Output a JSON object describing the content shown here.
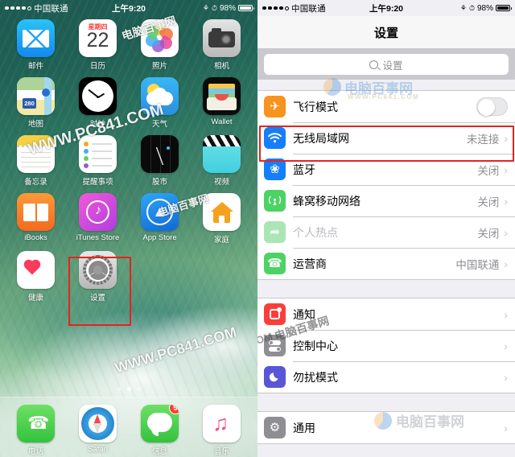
{
  "status_bar": {
    "carrier": "中国联通",
    "time": "上午9:20",
    "battery_percent": "98%",
    "signal_dots": 5,
    "signal_filled": 4,
    "rotation_lock_icon": "rotation-lock-icon",
    "alarm_icon": "alarm-icon"
  },
  "home_screen": {
    "rows": [
      [
        {
          "label": "邮件",
          "icon": "mail-icon"
        },
        {
          "label": "日历",
          "icon": "calendar-icon",
          "weekday": "星期四",
          "day": "22"
        },
        {
          "label": "照片",
          "icon": "photos-icon"
        },
        {
          "label": "相机",
          "icon": "camera-icon"
        }
      ],
      [
        {
          "label": "地图",
          "icon": "maps-icon",
          "route": "280"
        },
        {
          "label": "时钟",
          "icon": "clock-icon"
        },
        {
          "label": "天气",
          "icon": "weather-icon"
        },
        {
          "label": "Wallet",
          "icon": "wallet-icon"
        }
      ],
      [
        {
          "label": "备忘录",
          "icon": "notes-icon"
        },
        {
          "label": "提醒事项",
          "icon": "reminders-icon"
        },
        {
          "label": "股市",
          "icon": "stocks-icon"
        },
        {
          "label": "视频",
          "icon": "videos-icon"
        }
      ],
      [
        {
          "label": "iBooks",
          "icon": "ibooks-icon"
        },
        {
          "label": "iTunes Store",
          "icon": "itunes-store-icon"
        },
        {
          "label": "App Store",
          "icon": "app-store-icon"
        },
        {
          "label": "家庭",
          "icon": "home-app-icon"
        }
      ],
      [
        {
          "label": "健康",
          "icon": "health-icon"
        },
        {
          "label": "设置",
          "icon": "settings-gear-icon"
        }
      ]
    ],
    "dock": [
      {
        "label": "电话",
        "icon": "phone-icon"
      },
      {
        "label": "Safari",
        "icon": "safari-icon"
      },
      {
        "label": "信息",
        "icon": "messages-icon",
        "badge": "9"
      },
      {
        "label": "音乐",
        "icon": "music-icon"
      }
    ],
    "page_dots": {
      "count": 3,
      "active_index": 1
    },
    "highlight_color": "#e8231d",
    "watermark": "WWW.PC841.COM"
  },
  "settings_screen": {
    "title": "设置",
    "search": {
      "placeholder": "设置",
      "icon": "search-icon"
    },
    "groups": [
      {
        "rows": [
          {
            "label": "飞行模式",
            "icon": "airplane-icon",
            "control": "toggle",
            "toggle_on": false,
            "icon_color": "#f7931e"
          },
          {
            "label": "无线局域网",
            "icon": "wifi-icon",
            "value": "未连接",
            "control": "chevron",
            "icon_color": "#157efb",
            "highlighted": true
          },
          {
            "label": "蓝牙",
            "icon": "bluetooth-icon",
            "value": "关闭",
            "control": "chevron",
            "icon_color": "#157efb"
          },
          {
            "label": "蜂窝移动网络",
            "icon": "cellular-icon",
            "value": "关闭",
            "control": "chevron",
            "icon_color": "#4cd364"
          },
          {
            "label": "个人热点",
            "icon": "hotspot-icon",
            "value": "关闭",
            "control": "chevron",
            "icon_color": "#a9e6b4",
            "disabled": true
          },
          {
            "label": "运营商",
            "icon": "carrier-phone-icon",
            "value": "中国联通",
            "control": "chevron",
            "icon_color": "#4cd364"
          }
        ]
      },
      {
        "rows": [
          {
            "label": "通知",
            "icon": "notifications-icon",
            "control": "chevron",
            "icon_color": "#fc3d39"
          },
          {
            "label": "控制中心",
            "icon": "control-center-icon",
            "control": "chevron",
            "icon_color": "#8e8e93"
          },
          {
            "label": "勿扰模式",
            "icon": "do-not-disturb-icon",
            "control": "chevron",
            "icon_color": "#5856d6"
          }
        ]
      },
      {
        "rows": [
          {
            "label": "通用",
            "icon": "general-gear-icon",
            "control": "chevron",
            "icon_color": "#8e8e93"
          }
        ]
      }
    ],
    "highlight_color": "#e8231d",
    "watermark_cn": "电脑百事网",
    "watermark_en": "WWW.PC841.COM"
  }
}
